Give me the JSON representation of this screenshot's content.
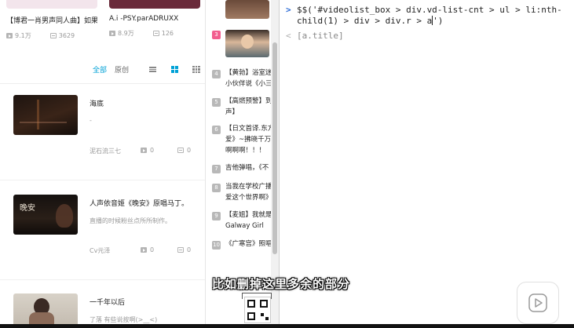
{
  "top_cards": [
    {
      "title": "【博君一肖男声同人曲】如果",
      "views": "9.1万",
      "comments": "3629",
      "color": "#f3e5ec"
    },
    {
      "title": "A.i -PSY.parADRUXX",
      "views": "8.9万",
      "comments": "126",
      "color": "#6a2a3a"
    }
  ],
  "filter": {
    "all": "全部",
    "original": "原创"
  },
  "videos": [
    {
      "title": "海底",
      "desc": "-",
      "uploader": "泥石流三七",
      "plays": "0",
      "comments": "0",
      "thumb_color": "#2a1a14"
    },
    {
      "title": "人声依音姬《晚安》原唱马丁。",
      "desc": "直播的时候粉丝点所所制作。",
      "uploader": "Cv元泽",
      "plays": "0",
      "comments": "0",
      "thumb_color": "#1c1512",
      "thumb_text": "晚安"
    },
    {
      "title": "一千年以后",
      "desc": "了落 有些说按啊(>__<)",
      "uploader": "",
      "plays": "",
      "comments": "",
      "thumb_color": "#c9c1b6"
    }
  ],
  "rank": [
    {
      "num": "3",
      "text": ""
    },
    {
      "num": "4",
      "text": "【黄勃】浴室迷\n小伙伴说《小三"
    },
    {
      "num": "5",
      "text": "【高燃预警】到\n声】"
    },
    {
      "num": "6",
      "text": "【日文首译.东方\n爱》~拂晓千万\n啊啊啊！！！"
    },
    {
      "num": "7",
      "text": "吉他弹唱，《不"
    },
    {
      "num": "8",
      "text": "当我在学校广播\n爱这个世界啊》"
    },
    {
      "num": "9",
      "text": "【麦姐】我就是\nGalway Girl"
    },
    {
      "num": "10",
      "text": "《广寒宫》照唱"
    }
  ],
  "console": {
    "prompt_symbol": ">",
    "code_prefix": "$$(",
    "code_selector": "'#videolist_box > div.vd-list-cnt > ul > li:nth-child(1) > div > div.r > a",
    "code_suffix": "')",
    "line1": "$$('#videolist_box > div.vd-list-cnt > ul > li:nth-",
    "line2_pre": "child(1) > div > div.r > a",
    "line2_post": "')",
    "output_arrow": "<",
    "output": "[a.title]"
  },
  "subtitle": "比如删掉这里多余的部分",
  "colors": {
    "accent": "#00a1d6",
    "rank_top": "#f25d8e",
    "console_prompt": "#2b6bd6"
  }
}
